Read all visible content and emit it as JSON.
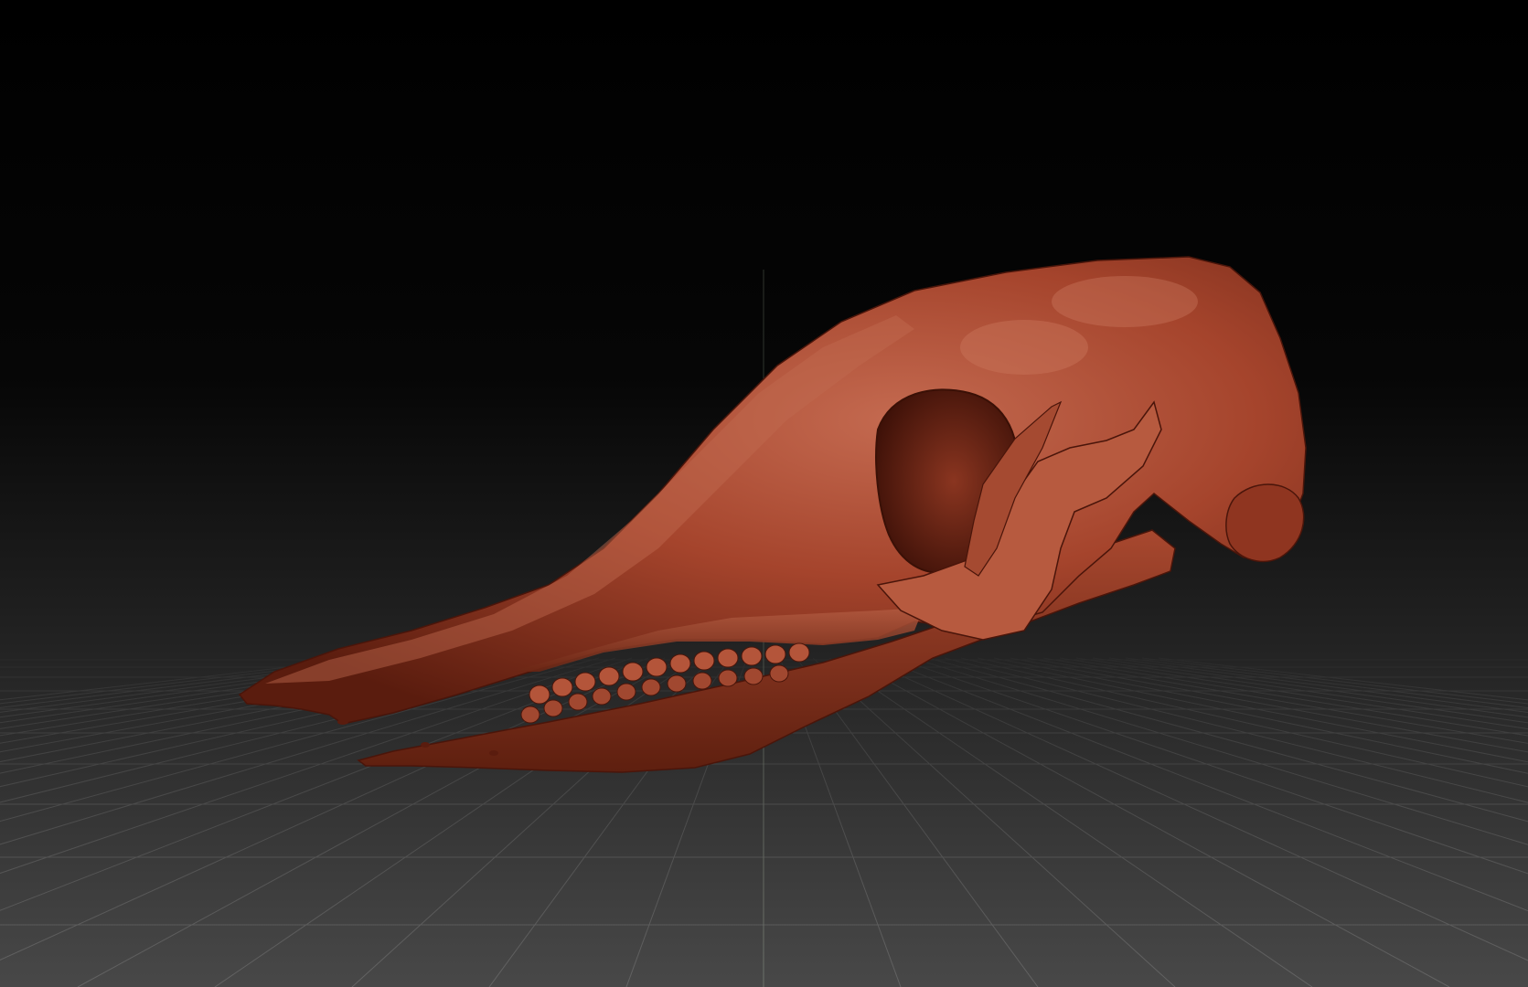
{
  "viewport": {
    "background_top": "#000000",
    "background_bottom": "#4a4a4a",
    "grid_color": "#6a6a6a",
    "axis_color": "#8aa080"
  },
  "model": {
    "icon": "skull-model",
    "material_color": "#a5442c",
    "highlight_color": "#d07a60",
    "shadow_color": "#4e170b"
  }
}
